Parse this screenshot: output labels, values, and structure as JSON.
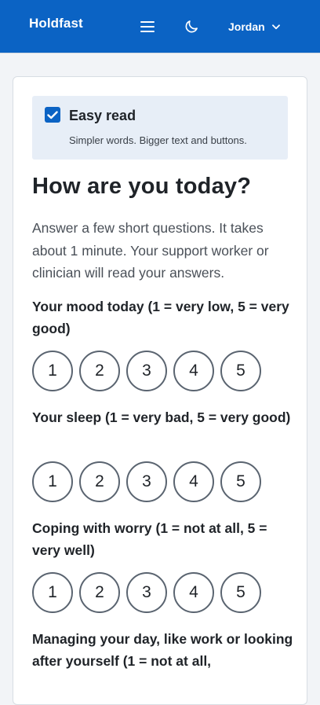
{
  "header": {
    "brand": "Holdfast",
    "user_name": "Jordan",
    "menu_icon": "hamburger-menu-icon",
    "theme_icon": "moon-icon",
    "user_dropdown_icon": "chevron-down-icon",
    "bg_color": "#0b63c4"
  },
  "easy_read": {
    "label": "Easy read",
    "help": "Simpler words. Bigger text and buttons.",
    "checked": true
  },
  "page": {
    "title": "How are you today?",
    "intro": "Answer a few short questions. It takes about 1 minute. Your support worker or clinician will read your answers."
  },
  "questions": [
    {
      "label": "Your mood today (1 = very low, 5 = very good)",
      "options": [
        "1",
        "2",
        "3",
        "4",
        "5"
      ]
    },
    {
      "label": "Your sleep (1 = very bad, 5 = very good)",
      "options": [
        "1",
        "2",
        "3",
        "4",
        "5"
      ]
    },
    {
      "label": "Coping with worry (1 = not at all, 5 = very well)",
      "options": [
        "1",
        "2",
        "3",
        "4",
        "5"
      ]
    },
    {
      "label": "Managing your day, like work or looking after yourself (1 = not at all,",
      "options": []
    }
  ]
}
